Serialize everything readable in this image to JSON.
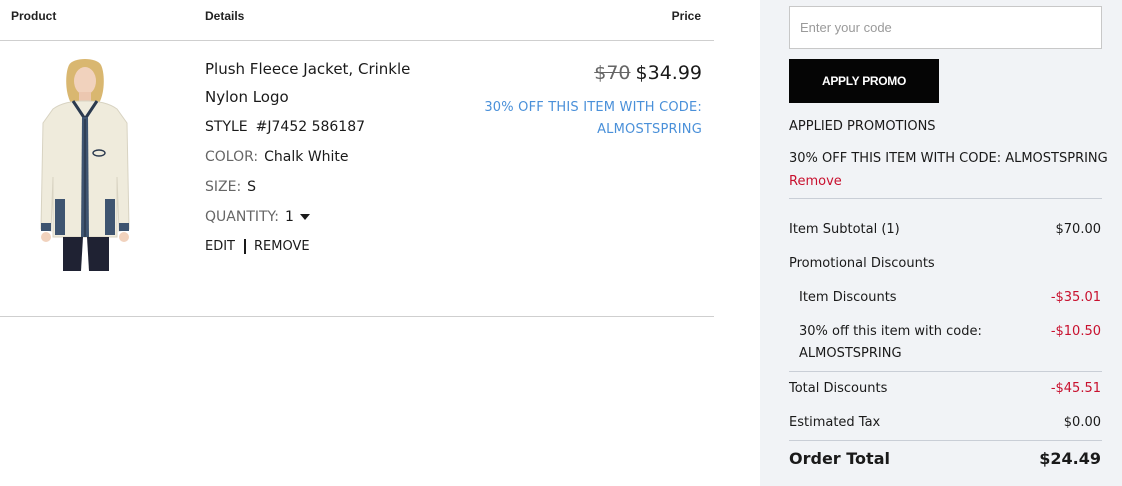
{
  "cart": {
    "headers": {
      "product": "Product",
      "details": "Details",
      "price": "Price"
    },
    "item": {
      "name": "Plush Fleece Jacket, Crinkle Nylon Logo",
      "style_label": "STYLE",
      "style_value": "#J7452 586187",
      "color_label": "COLOR:",
      "color_value": "Chalk White",
      "size_label": "SIZE:",
      "size_value": "S",
      "quantity_label": "QUANTITY:",
      "quantity_value": "1",
      "edit_label": "EDIT",
      "remove_label": "REMOVE",
      "original_price": "$70",
      "sale_price": "$34.99",
      "promo_note": "30% OFF THIS ITEM WITH CODE: ALMOSTSPRING",
      "image": {
        "icon": "fleece-jacket-photo",
        "jacket_color": "#efebdc",
        "trim_color": "#3e5470"
      }
    }
  },
  "summary": {
    "promo_placeholder": "Enter your code",
    "promo_value": "",
    "apply_label": "APPLY PROMO",
    "applied_title": "APPLIED PROMOTIONS",
    "applied_promo": "30% OFF THIS ITEM WITH CODE: ALMOSTSPRING",
    "remove_label": "Remove",
    "rows": {
      "subtotal_label": "Item Subtotal (1)",
      "subtotal_value": "$70.00",
      "promo_discounts_label": "Promotional Discounts",
      "item_discounts_label": "Item Discounts",
      "item_discounts_value": "-$35.01",
      "code_discount_label": "30% off this item with code: ALMOSTSPRING",
      "code_discount_value": "-$10.50",
      "total_discounts_label": "Total Discounts",
      "total_discounts_value": "-$45.51",
      "tax_label": "Estimated Tax",
      "tax_value": "$0.00",
      "order_total_label": "Order Total",
      "order_total_value": "$24.49"
    }
  },
  "colors": {
    "accent_link": "#4a90d9",
    "discount_red": "#c8102e",
    "summary_bg": "#f1f3f6",
    "button_bg": "#050505"
  }
}
